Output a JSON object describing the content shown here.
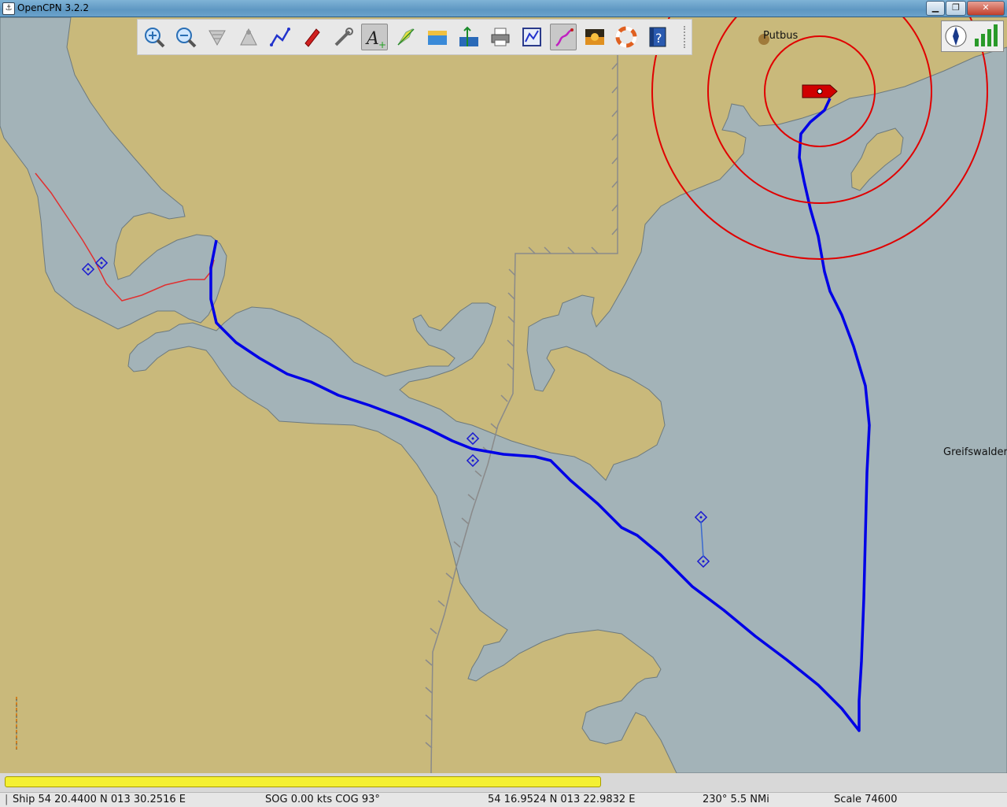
{
  "window": {
    "title": "OpenCPN 3.2.2",
    "minimize": "▁",
    "maximize": "❐",
    "close": "✕"
  },
  "toolbar": {
    "items": [
      {
        "name": "zoom-in-icon",
        "label": "Zoom In"
      },
      {
        "name": "zoom-out-icon",
        "label": "Zoom Out"
      },
      {
        "name": "quilt-down-icon",
        "label": "Shift Down"
      },
      {
        "name": "quilt-up-icon",
        "label": "Shift Up"
      },
      {
        "name": "route-icon",
        "label": "Create Route"
      },
      {
        "name": "follow-ship-icon",
        "label": "Auto Follow"
      },
      {
        "name": "settings-icon",
        "label": "Settings"
      },
      {
        "name": "text-toggle-icon",
        "label": "Show ENC Text"
      },
      {
        "name": "current-icon",
        "label": "Show Currents"
      },
      {
        "name": "tide-icon",
        "label": "Show Tides"
      },
      {
        "name": "ais-icon",
        "label": "AIS"
      },
      {
        "name": "print-icon",
        "label": "Print Chart"
      },
      {
        "name": "route-manager-icon",
        "label": "Route Manager"
      },
      {
        "name": "track-icon",
        "label": "Enable Tracking"
      },
      {
        "name": "color-scheme-icon",
        "label": "Change Color Scheme"
      },
      {
        "name": "mob-icon",
        "label": "Man Overboard"
      },
      {
        "name": "help-icon",
        "label": "About OpenCPN"
      }
    ],
    "active": [
      7,
      13
    ]
  },
  "chart": {
    "place_labels": [
      "Putbus",
      "Greifswalder"
    ],
    "colors": {
      "land": "#c9b97b",
      "water": "#a3b3b8",
      "track": "#0000e6",
      "range_rings": "#e00000",
      "ownship": "#d00000"
    }
  },
  "progress": {
    "fraction": 0.6
  },
  "status": {
    "ship": "Ship 54 20.4400 N   013 30.2516 E",
    "sog": "SOG 0.00 kts   COG 93°",
    "cursor": "54 16.9524 N    013 22.9832 E",
    "bearing": "230°   5.5 NMi",
    "scale": "Scale 74600"
  }
}
